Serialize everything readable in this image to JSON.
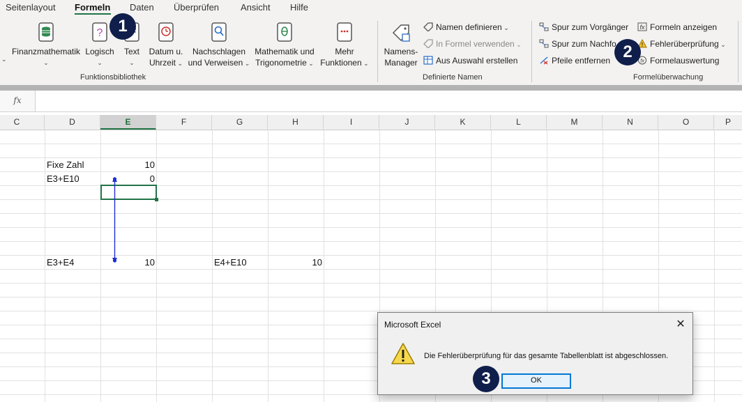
{
  "ribbon": {
    "tabs": [
      "Seitenlayout",
      "Formeln",
      "Daten",
      "Überprüfen",
      "Ansicht",
      "Hilfe"
    ],
    "active_tab": "Formeln",
    "funktionsbibliothek": {
      "finanz": "Finanzmathematik",
      "logisch": "Logisch",
      "text": "Text",
      "datum_1": "Datum u.",
      "datum_2": "Uhrzeit",
      "nach_1": "Nachschlagen",
      "nach_2": "und Verweisen",
      "math_1": "Mathematik und",
      "math_2": "Trigonometrie",
      "mehr_1": "Mehr",
      "mehr_2": "Funktionen",
      "group_label": "Funktionsbibliothek"
    },
    "definierte_namen": {
      "manager_1": "Namens-",
      "manager_2": "Manager",
      "definieren": "Namen definieren",
      "verwenden": "In Formel verwenden",
      "auswahl": "Aus Auswahl erstellen",
      "group_label": "Definierte Namen"
    },
    "formelueberwachung": {
      "vorgaenger": "Spur zum Vorgänger",
      "nachfolger": "Spur zum Nachfo",
      "pfeile": "Pfeile entfernen",
      "anzeigen": "Formeln anzeigen",
      "fehler": "Fehlerüberprüfung",
      "auswertung": "Formelauswertung",
      "group_label": "Formelüberwachung"
    }
  },
  "formula_bar": {
    "fx": "fx",
    "value": ""
  },
  "columns": [
    "C",
    "D",
    "E",
    "F",
    "G",
    "H",
    "I",
    "J",
    "K",
    "L",
    "M",
    "N",
    "O",
    "P"
  ],
  "selected_column": "E",
  "cells": {
    "d_fixe": "Fixe Zahl",
    "e_fixe": "10",
    "d_e3e10": "E3+E10",
    "e_e3e10": "0",
    "d_e3e4": "E3+E4",
    "e_e3e4": "10",
    "g_e4e10": "E4+E10",
    "h_e4e10": "10"
  },
  "dialog": {
    "title": "Microsoft Excel",
    "close": "✕",
    "message": "Die Fehlerüberprüfung für das gesamte Tabellenblatt ist abgeschlossen.",
    "ok": "OK"
  },
  "badges": {
    "b1": "1",
    "b2": "2",
    "b3": "3"
  },
  "colors": {
    "excel_green": "#217346",
    "badge_navy": "#0f1e4a",
    "arrow_blue": "#1f2fd0"
  }
}
